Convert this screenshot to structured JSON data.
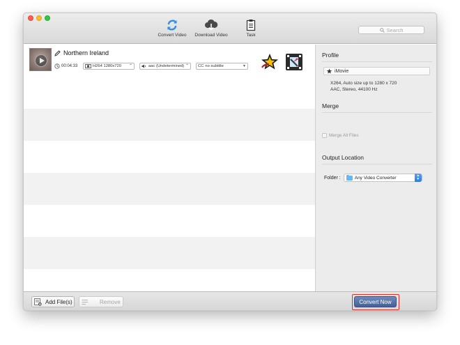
{
  "toolbar": {
    "convert_video": "Convert Video",
    "download_video": "Download Video",
    "task": "Task",
    "search_placeholder": "Search"
  },
  "file": {
    "title": "Northern Ireland",
    "duration": "00:04:33",
    "video_track": "H264 1280x720",
    "audio_track": "aac (Undetermined)",
    "subtitle": "no subtitle",
    "subtitle_prefix": "CC"
  },
  "side": {
    "profile_title": "Profile",
    "profile_name": "iMovie",
    "profile_desc_1": "X264, Auto size up to 1280 x 720",
    "profile_desc_2": "AAC, Stereo, 44100 Hz",
    "merge_title": "Merge",
    "merge_label": "Merge All Files",
    "output_title": "Output Location",
    "folder_label": "Folder :",
    "folder_value": "Any Video Converter"
  },
  "bottom": {
    "add_files": "Add File(s)",
    "remove": "Remove",
    "convert_now": "Convert Now"
  },
  "colors": {
    "accent": "#4a6aa0",
    "highlight_border": "#d9312a",
    "window_close": "#fc5f57",
    "window_min": "#fdbc2e",
    "window_max": "#33c748"
  }
}
